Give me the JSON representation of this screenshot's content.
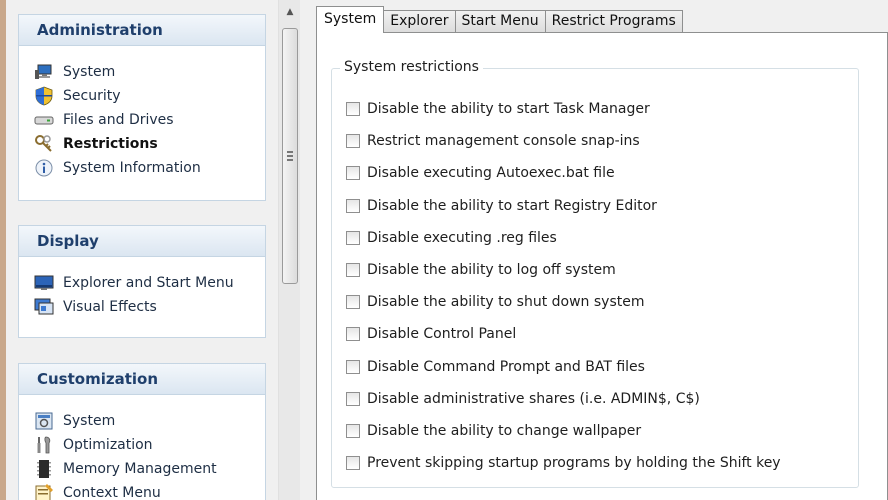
{
  "sidebar": {
    "groups": [
      {
        "title": "Administration",
        "items": [
          {
            "label": "System",
            "icon": "computer-icon"
          },
          {
            "label": "Security",
            "icon": "shield-icon"
          },
          {
            "label": "Files and Drives",
            "icon": "drive-icon"
          },
          {
            "label": "Restrictions",
            "icon": "keys-icon",
            "active": true
          },
          {
            "label": "System Information",
            "icon": "info-icon"
          }
        ]
      },
      {
        "title": "Display",
        "items": [
          {
            "label": "Explorer and Start Menu",
            "icon": "monitor-icon"
          },
          {
            "label": "Visual Effects",
            "icon": "visual-effects-icon"
          }
        ]
      },
      {
        "title": "Customization",
        "items": [
          {
            "label": "System",
            "icon": "system-config-icon"
          },
          {
            "label": "Optimization",
            "icon": "wrench-icon"
          },
          {
            "label": "Memory Management",
            "icon": "memory-chip-icon"
          },
          {
            "label": "Context Menu",
            "icon": "context-menu-icon"
          }
        ]
      }
    ]
  },
  "tabs": [
    {
      "label": "System",
      "active": true
    },
    {
      "label": "Explorer"
    },
    {
      "label": "Start Menu"
    },
    {
      "label": "Restrict Programs"
    }
  ],
  "restrictions": {
    "legend": "System restrictions",
    "options": [
      {
        "label": "Disable the ability to start Task Manager",
        "checked": false
      },
      {
        "label": "Restrict management console snap-ins",
        "checked": false
      },
      {
        "label": "Disable executing Autoexec.bat file",
        "checked": false
      },
      {
        "label": "Disable the ability to start Registry Editor",
        "checked": false
      },
      {
        "label": "Disable executing .reg files",
        "checked": false
      },
      {
        "label": "Disable the ability to log off system",
        "checked": false
      },
      {
        "label": "Disable the ability to shut down system",
        "checked": false
      },
      {
        "label": "Disable Control Panel",
        "checked": false
      },
      {
        "label": "Disable Command Prompt and BAT files",
        "checked": false
      },
      {
        "label": "Disable administrative shares (i.e. ADMIN$, C$)",
        "checked": false
      },
      {
        "label": "Disable the ability to change wallpaper",
        "checked": false
      },
      {
        "label": "Prevent skipping startup programs by holding the Shift key",
        "checked": false
      }
    ]
  },
  "colors": {
    "group_header_text": "#1f3f6c",
    "group_border": "#c5d5e3",
    "window_bg": "#f0f0f0",
    "desktop_bg": "#c9a88b"
  }
}
